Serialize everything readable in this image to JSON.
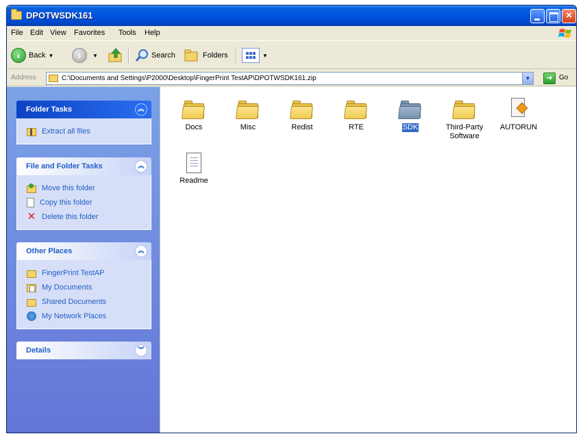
{
  "window": {
    "title": "DPOTWSDK161"
  },
  "menu": [
    "File",
    "Edit",
    "View",
    "Favorites",
    "Tools",
    "Help"
  ],
  "toolbar": {
    "back_label": "Back",
    "search_label": "Search",
    "folders_label": "Folders"
  },
  "address": {
    "label": "Address",
    "path": "C:\\Documents and Settings\\P2000\\Desktop\\FingerPrint TestAP\\DPOTWSDK161.zip",
    "go_label": "Go"
  },
  "folder_tasks": {
    "title": "Folder Tasks",
    "items": [
      "Extract all files"
    ]
  },
  "file_folder_tasks": {
    "title": "File and Folder Tasks",
    "items": [
      "Move this folder",
      "Copy this folder",
      "Delete this folder"
    ]
  },
  "other_places": {
    "title": "Other Places",
    "items": [
      "FingerPrint TestAP",
      "My Documents",
      "Shared Documents",
      "My Network Places"
    ]
  },
  "details": {
    "title": "Details"
  },
  "files": [
    {
      "name": "Docs",
      "icon": "folder-icon"
    },
    {
      "name": "Misc",
      "icon": "folder-icon"
    },
    {
      "name": "Redist",
      "icon": "folder-icon"
    },
    {
      "name": "RTE",
      "icon": "folder-icon"
    },
    {
      "name": "SDK",
      "icon": "folder-icon",
      "selected": true
    },
    {
      "name": "Third-Party Software",
      "icon": "folder-icon"
    },
    {
      "name": "AUTORUN",
      "icon": "autorun-icon"
    },
    {
      "name": "Readme",
      "icon": "text-document-icon"
    }
  ],
  "colors": {
    "title_bar": "#0054e3",
    "task_pane": "#7ba2e7",
    "link": "#215dc6",
    "selection": "#316ac5"
  }
}
